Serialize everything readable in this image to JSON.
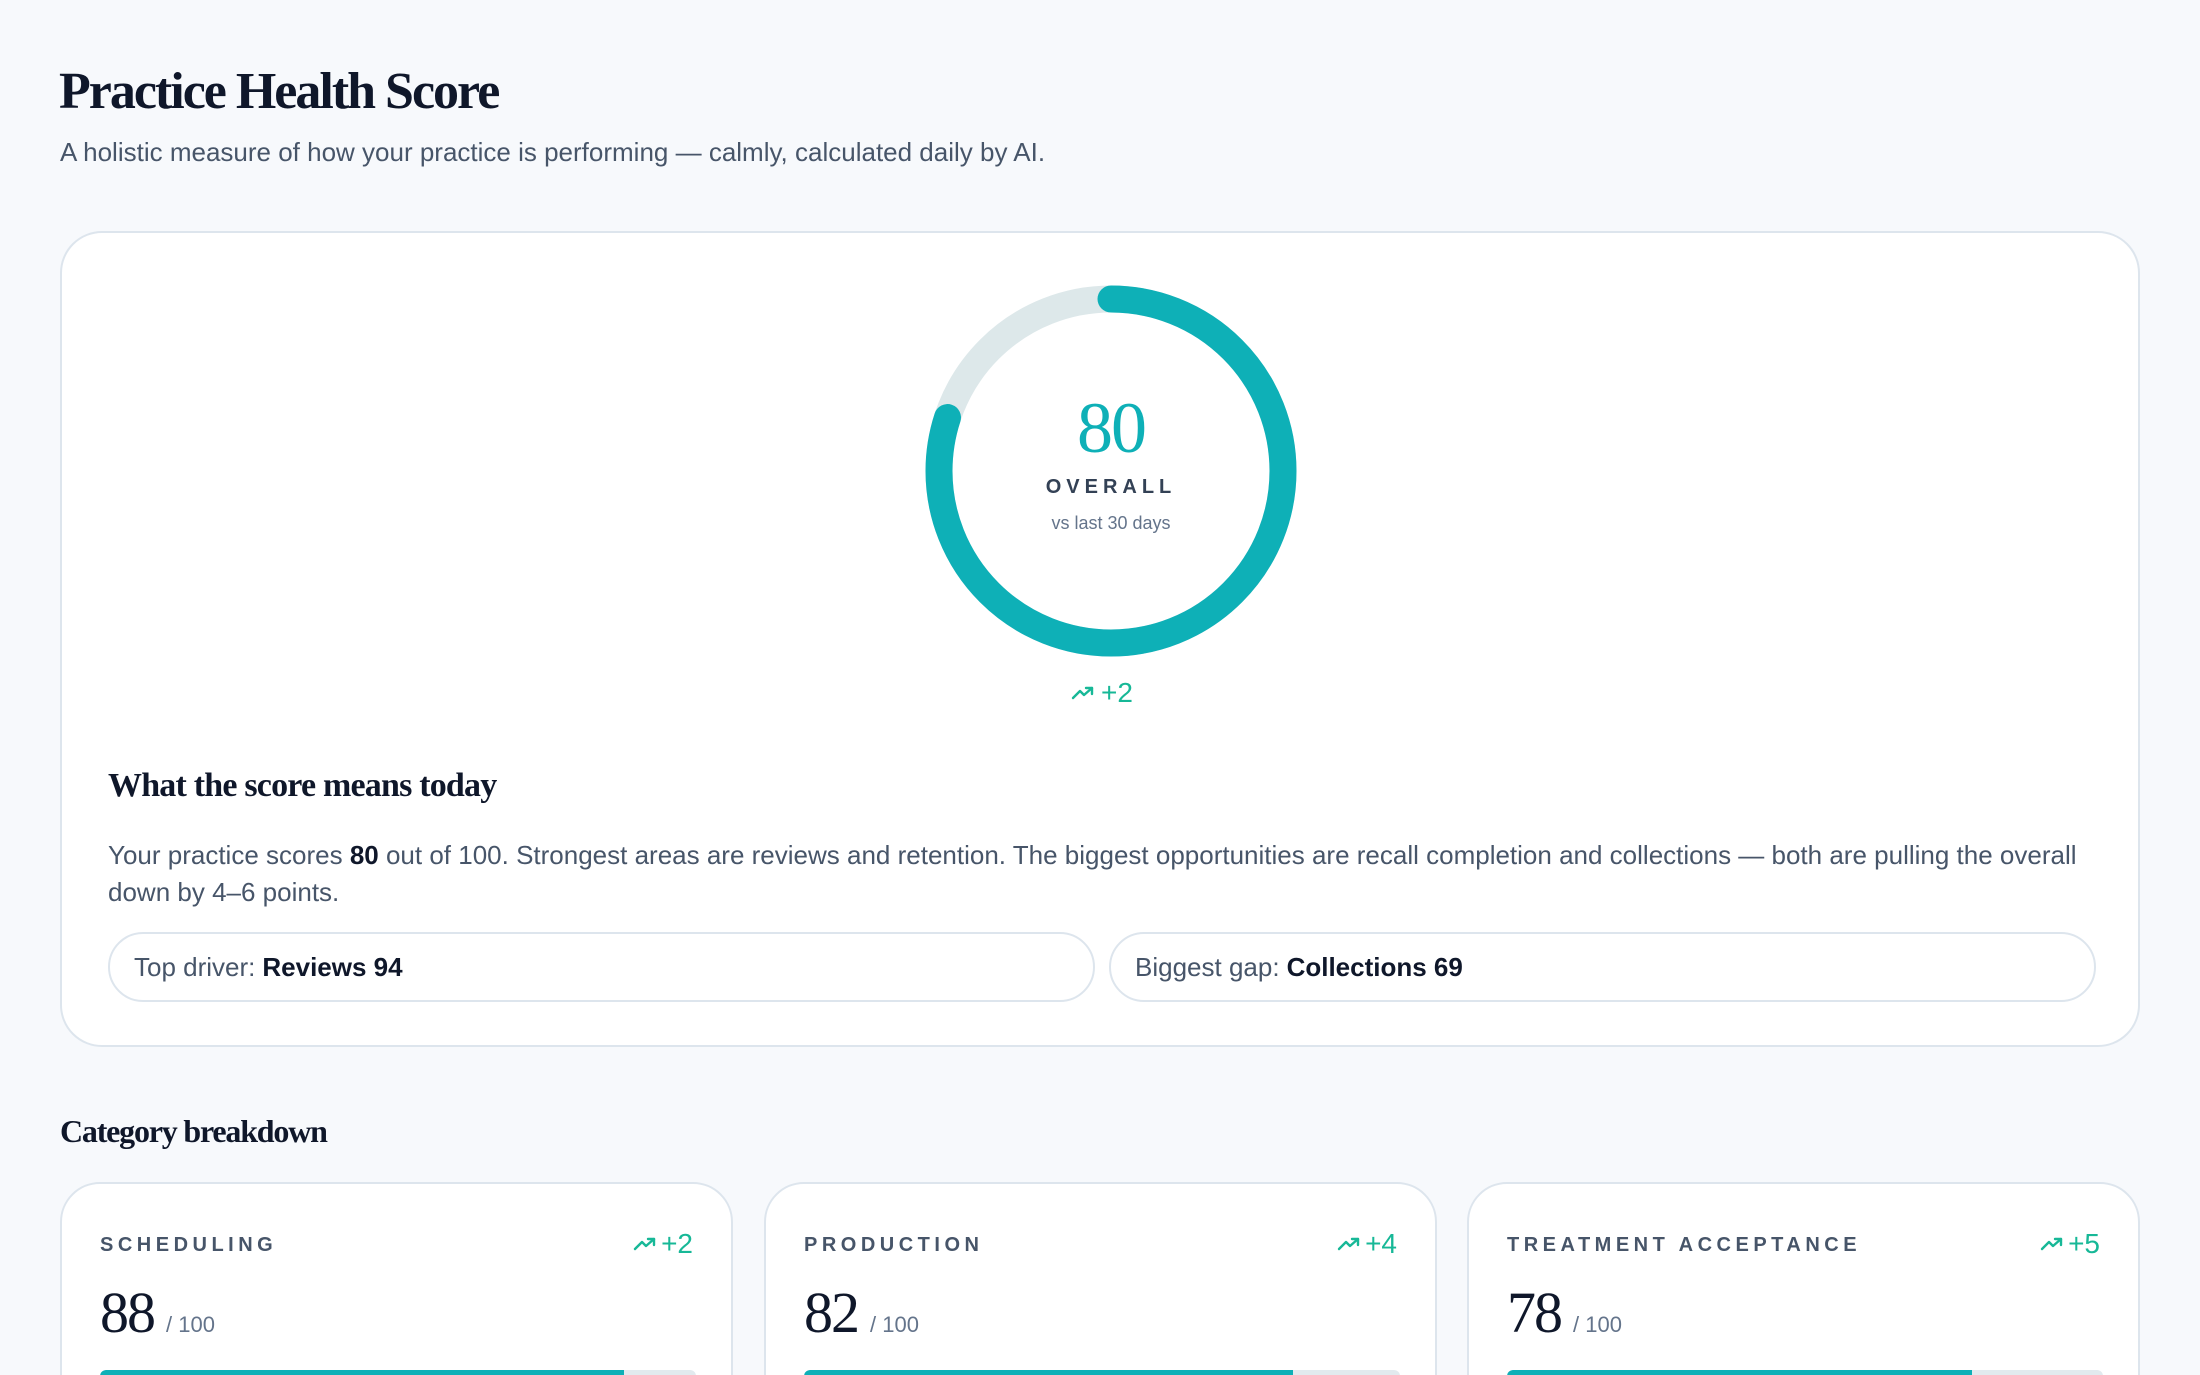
{
  "header": {
    "title": "Practice Health Score",
    "subtitle": "A holistic measure of how your practice is performing — calmly, calculated daily by AI."
  },
  "overall": {
    "score": 80,
    "max": 100,
    "label": "OVERALL",
    "comparison": "vs last 30 days",
    "trend": "+2",
    "trend_icon": "trending-up-icon",
    "colors": {
      "progress": "#0eb0b7",
      "track": "#dde8ea",
      "trend": "#17b897"
    }
  },
  "summary": {
    "title": "What the score means today",
    "text_before": "Your practice scores ",
    "text_bold": "80",
    "text_after": " out of 100. Strongest areas are reviews and retention. The biggest opportunities are recall completion and collections — both are pulling the overall down by 4–6 points.",
    "top_driver_label": "Top driver:",
    "top_driver_value": "Reviews 94",
    "biggest_gap_label": "Biggest gap:",
    "biggest_gap_value": "Collections 69"
  },
  "breakdown": {
    "title": "Category breakdown",
    "max_label": "/ 100",
    "categories": [
      {
        "name": "SCHEDULING",
        "score": 88,
        "trend": "+2"
      },
      {
        "name": "PRODUCTION",
        "score": 82,
        "trend": "+4"
      },
      {
        "name": "TREATMENT ACCEPTANCE",
        "score": 78,
        "trend": "+5"
      }
    ]
  }
}
